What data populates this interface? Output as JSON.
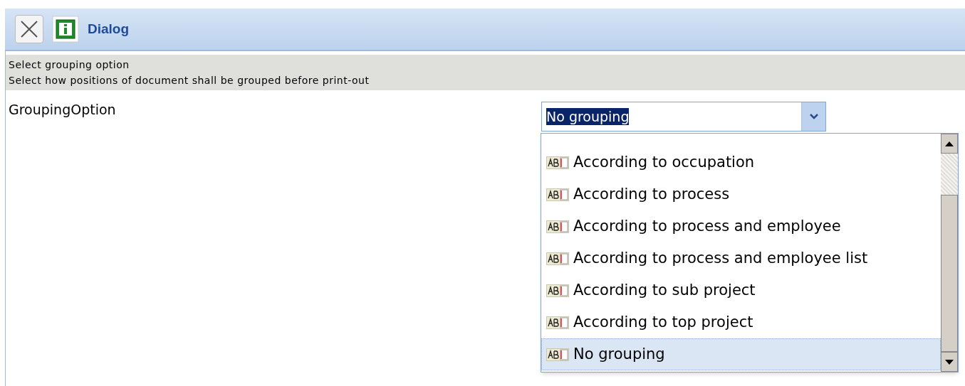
{
  "window": {
    "title": "Dialog"
  },
  "header": {
    "title": "Select grouping option",
    "description": "Select how positions of document shall be grouped before print-out"
  },
  "field": {
    "label": "GroupingOption",
    "value": "No grouping",
    "expanded": true
  },
  "options": [
    {
      "label": "According to occupation",
      "selected": false
    },
    {
      "label": "According to process",
      "selected": false
    },
    {
      "label": "According to process and employee",
      "selected": false
    },
    {
      "label": "According to process and employee list",
      "selected": false
    },
    {
      "label": "According to sub project",
      "selected": false
    },
    {
      "label": "According to top project",
      "selected": false
    },
    {
      "label": "No grouping",
      "selected": true
    }
  ]
}
